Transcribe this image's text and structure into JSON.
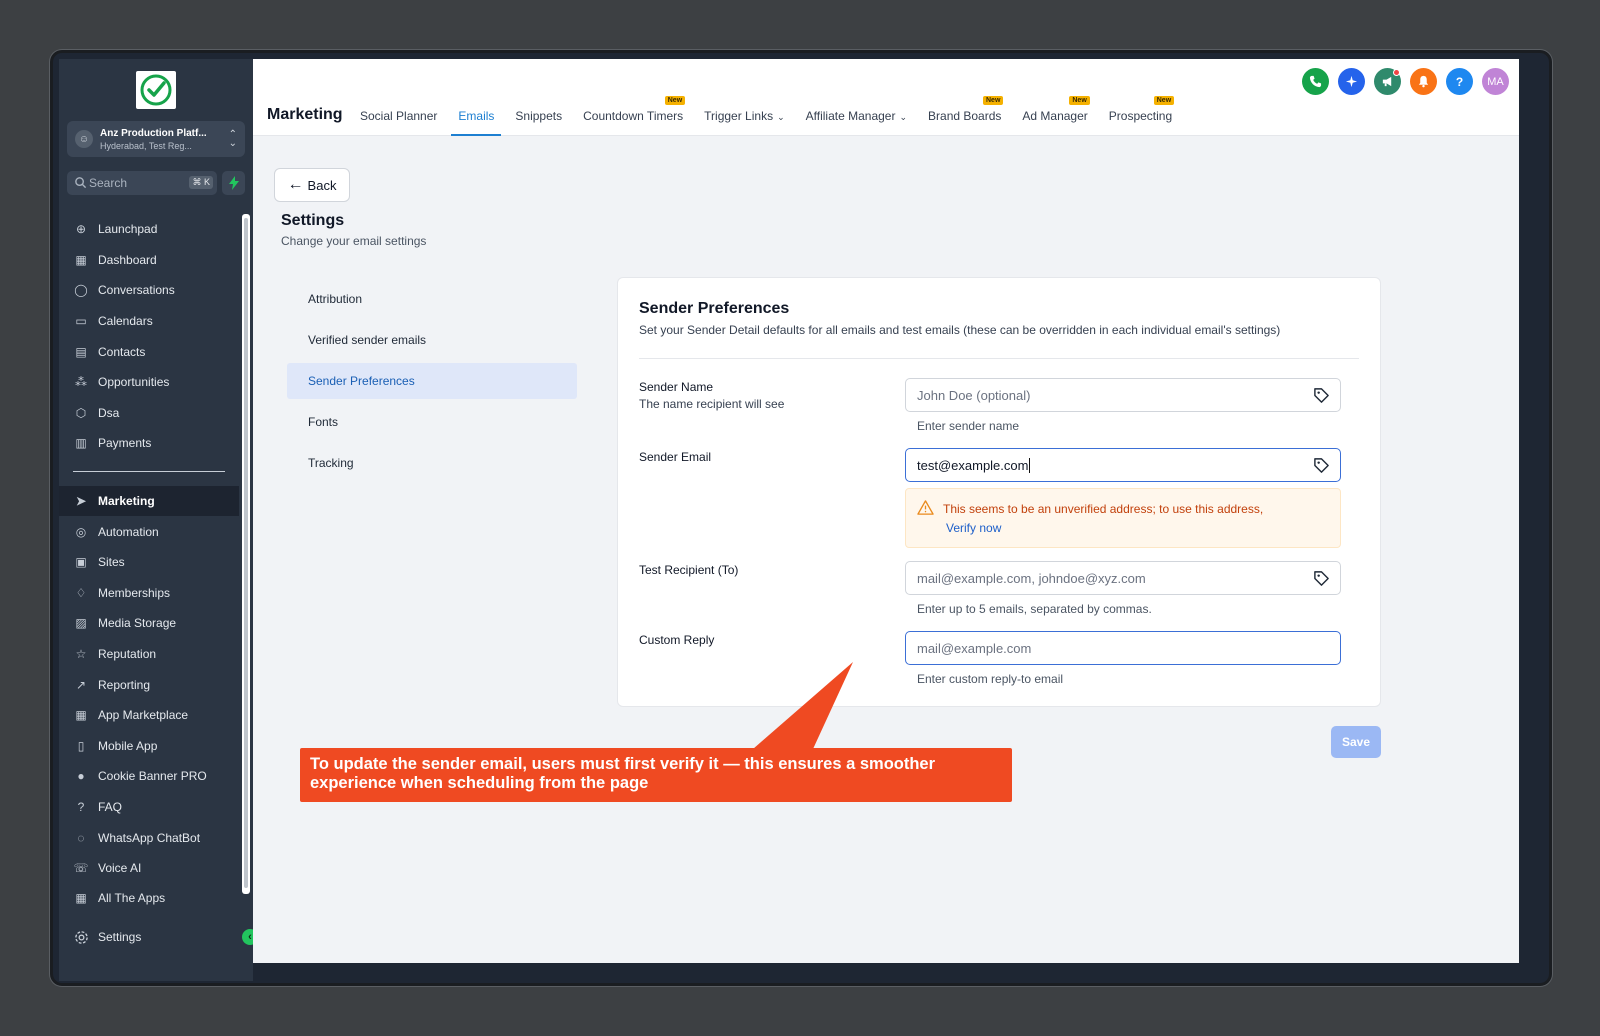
{
  "sidebar": {
    "account": {
      "name": "Anz Production Platf...",
      "location": "Hyderabad, Test Reg..."
    },
    "search": {
      "placeholder": "Search",
      "shortcut": "⌘ K"
    },
    "nav_items": [
      {
        "label": "Launchpad",
        "icon": "launchpad-icon"
      },
      {
        "label": "Dashboard",
        "icon": "dashboard-icon"
      },
      {
        "label": "Conversations",
        "icon": "chat-icon"
      },
      {
        "label": "Calendars",
        "icon": "calendar-icon"
      },
      {
        "label": "Contacts",
        "icon": "contacts-icon"
      },
      {
        "label": "Opportunities",
        "icon": "opportunities-icon"
      },
      {
        "label": "Dsa",
        "icon": "cube-icon"
      },
      {
        "label": "Payments",
        "icon": "receipt-icon"
      }
    ],
    "nav_items_2": [
      {
        "label": "Marketing",
        "icon": "send-icon",
        "active": true
      },
      {
        "label": "Automation",
        "icon": "automation-icon"
      },
      {
        "label": "Sites",
        "icon": "sites-icon"
      },
      {
        "label": "Memberships",
        "icon": "award-icon"
      },
      {
        "label": "Media Storage",
        "icon": "image-icon"
      },
      {
        "label": "Reputation",
        "icon": "star-icon"
      },
      {
        "label": "Reporting",
        "icon": "trend-icon"
      },
      {
        "label": "App Marketplace",
        "icon": "grid-icon"
      },
      {
        "label": "Mobile App",
        "icon": "mobile-icon"
      },
      {
        "label": "Cookie Banner PRO",
        "icon": "cookie-icon"
      },
      {
        "label": "FAQ",
        "icon": "question-icon"
      },
      {
        "label": "WhatsApp ChatBot",
        "icon": "whatsapp-icon"
      },
      {
        "label": "Voice AI",
        "icon": "phone-icon"
      }
    ],
    "partial_item": "All The Apps",
    "settings_label": "Settings"
  },
  "header": {
    "title": "Marketing",
    "tabs": [
      {
        "label": "Social Planner"
      },
      {
        "label": "Emails",
        "active": true
      },
      {
        "label": "Snippets"
      },
      {
        "label": "Countdown Timers",
        "badge": "New"
      },
      {
        "label": "Trigger Links",
        "dropdown": true
      },
      {
        "label": "Affiliate Manager",
        "dropdown": true
      },
      {
        "label": "Brand Boards",
        "badge": "New"
      },
      {
        "label": "Ad Manager",
        "badge": "New"
      },
      {
        "label": "Prospecting",
        "badge": "New"
      }
    ],
    "avatar_initials": "MA",
    "help_glyph": "?"
  },
  "page": {
    "back_label": "Back",
    "title": "Settings",
    "subtitle": "Change your email settings",
    "submenu": [
      "Attribution",
      "Verified sender emails",
      "Sender Preferences",
      "Fonts",
      "Tracking"
    ]
  },
  "card": {
    "title": "Sender Preferences",
    "subtitle": "Set your Sender Detail defaults for all emails and test emails (these can be overridden in each individual email's settings)",
    "sender_name": {
      "label": "Sender Name",
      "sub": "The name recipient will see",
      "placeholder": "John Doe (optional)",
      "help": "Enter sender name"
    },
    "sender_email": {
      "label": "Sender Email",
      "value": "test@example.com",
      "warning": "This seems to be an unverified address; to use this address,",
      "verify_link": "Verify now"
    },
    "test_recipient": {
      "label": "Test Recipient (To)",
      "placeholder": "mail@example.com, johndoe@xyz.com",
      "help": "Enter up to 5 emails, separated by commas."
    },
    "custom_reply": {
      "label": "Custom Reply",
      "placeholder": "mail@example.com",
      "help": "Enter custom reply-to email"
    }
  },
  "save_label": "Save",
  "callout": "To update the sender email, users must first verify it — this ensures a smoother experience when scheduling from the page",
  "colors": {
    "accent": "#1d7fd1",
    "callout": "#ef4a22",
    "sidebar": "#2b3543",
    "warning": "#c2410c"
  }
}
